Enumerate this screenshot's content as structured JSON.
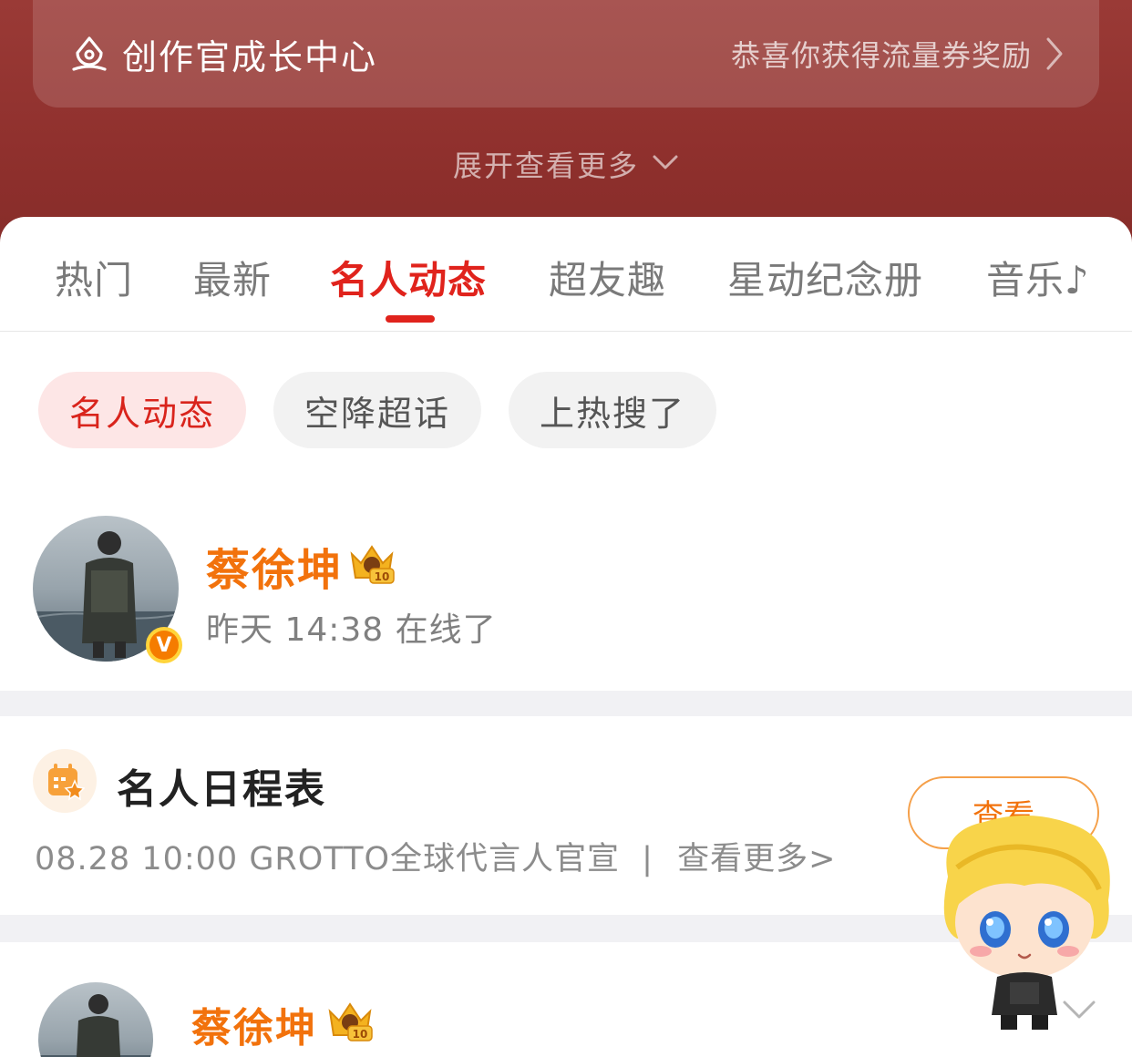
{
  "creator_center": {
    "title": "创作官成长中心",
    "reward_text": "恭喜你获得流量券奖励",
    "icon": "creator-pen-icon"
  },
  "expand": {
    "label": "展开查看更多"
  },
  "tabs": [
    {
      "label": "热门",
      "active": false
    },
    {
      "label": "最新",
      "active": false
    },
    {
      "label": "名人动态",
      "active": true
    },
    {
      "label": "超友趣",
      "active": false
    },
    {
      "label": "星动纪念册",
      "active": false
    },
    {
      "label": "音乐♪",
      "active": false
    }
  ],
  "chips": [
    {
      "label": "名人动态",
      "active": true
    },
    {
      "label": "空降超话",
      "active": false
    },
    {
      "label": "上热搜了",
      "active": false
    }
  ],
  "profile": {
    "name": "蔡徐坤",
    "status": "昨天 14:38 在线了",
    "verified_badge": "V",
    "level": "10"
  },
  "schedule": {
    "title": "名人日程表",
    "line": "08.28 10:00 GROTTO全球代言人官宣",
    "separator": "|",
    "more": "查看更多>",
    "view_button": "查看"
  },
  "post": {
    "name": "蔡徐坤",
    "level": "10"
  },
  "colors": {
    "header": "#8f302d",
    "accent_red": "#e0231c",
    "accent_orange": "#f2720c"
  }
}
